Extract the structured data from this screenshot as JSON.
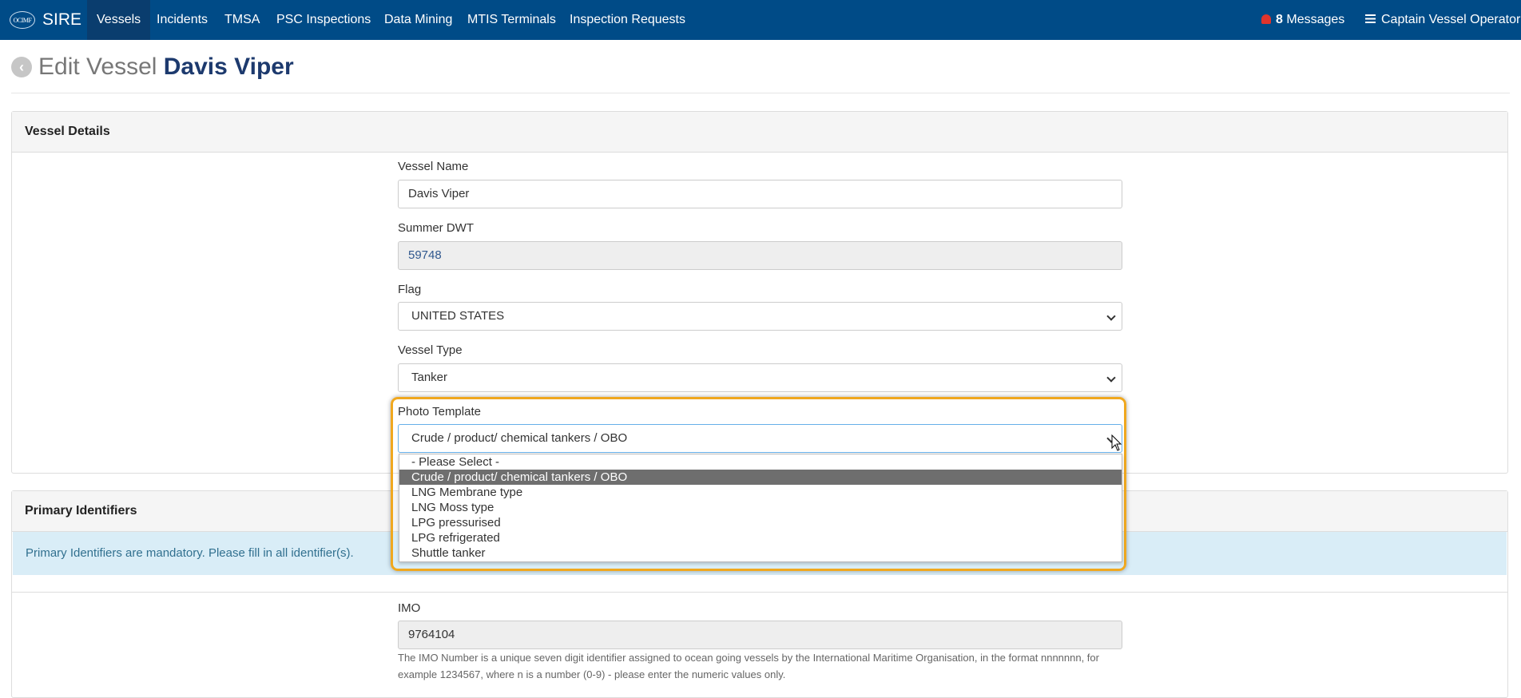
{
  "nav": {
    "brand_logo": "OCIMF",
    "brand_name": "SIRE",
    "items": [
      {
        "label": "Vessels",
        "active": true
      },
      {
        "label": "Incidents"
      },
      {
        "label": "TMSA"
      },
      {
        "label": "PSC Inspections"
      },
      {
        "label": "Data Mining"
      },
      {
        "label": "MTIS Terminals"
      },
      {
        "label": "Inspection Requests"
      }
    ],
    "messages_count": "8",
    "messages_label": "Messages",
    "user_label": "Captain Vessel Operator"
  },
  "page": {
    "title_prefix": "Edit Vessel",
    "title_vessel": "Davis Viper"
  },
  "vessel_details": {
    "heading": "Vessel Details",
    "vessel_name_label": "Vessel Name",
    "vessel_name_value": "Davis Viper",
    "summer_dwt_label": "Summer DWT",
    "summer_dwt_value": "59748",
    "flag_label": "Flag",
    "flag_value": "UNITED STATES",
    "vessel_type_label": "Vessel Type",
    "vessel_type_value": "Tanker",
    "photo_template_label": "Photo Template",
    "photo_template_value": "Crude / product/ chemical tankers / OBO",
    "photo_template_options": [
      "- Please Select -",
      "Crude / product/ chemical tankers / OBO",
      "LNG Membrane type",
      "LNG Moss type",
      "LPG pressurised",
      "LPG refrigerated",
      "Shuttle tanker"
    ]
  },
  "primary_identifiers": {
    "heading": "Primary Identifiers",
    "alert": "Primary Identifiers are mandatory. Please fill in all identifier(s).",
    "imo_label": "IMO",
    "imo_value": "9764104",
    "imo_help": "The IMO Number is a unique seven digit identifier assigned to ocean going vessels by the International Maritime Organisation, in the format nnnnnnn, for example 1234567, where n is a number (0-9) - please enter the numeric values only."
  },
  "colors": {
    "navbar": "#004b87",
    "nav_active": "#0a3d6e",
    "highlight": "#f0a81f",
    "alert_bg": "#d9edf7",
    "bell": "#e0342b"
  }
}
